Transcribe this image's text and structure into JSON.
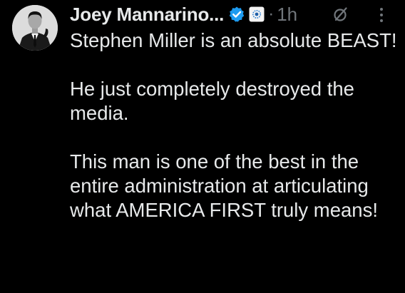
{
  "post": {
    "author_name": "Joey Mannarino...",
    "separator": "·",
    "time": "1h",
    "avatar_icon": "profile-photo",
    "verified_icon": "verified-badge-icon",
    "affiliate_icon": "affiliate-badge-icon",
    "grok_icon": "grok-icon",
    "more_icon": "more-options-icon",
    "paragraphs": [
      "Stephen Miller is an absolute BEAST!",
      "He just completely destroyed the media.",
      "This man is one of the best in the entire administration at articulating what AMERICA FIRST truly means!"
    ]
  },
  "colors": {
    "background": "#000000",
    "text": "#e7e9ea",
    "muted": "#71767b",
    "verified_blue": "#1d9bf0"
  }
}
